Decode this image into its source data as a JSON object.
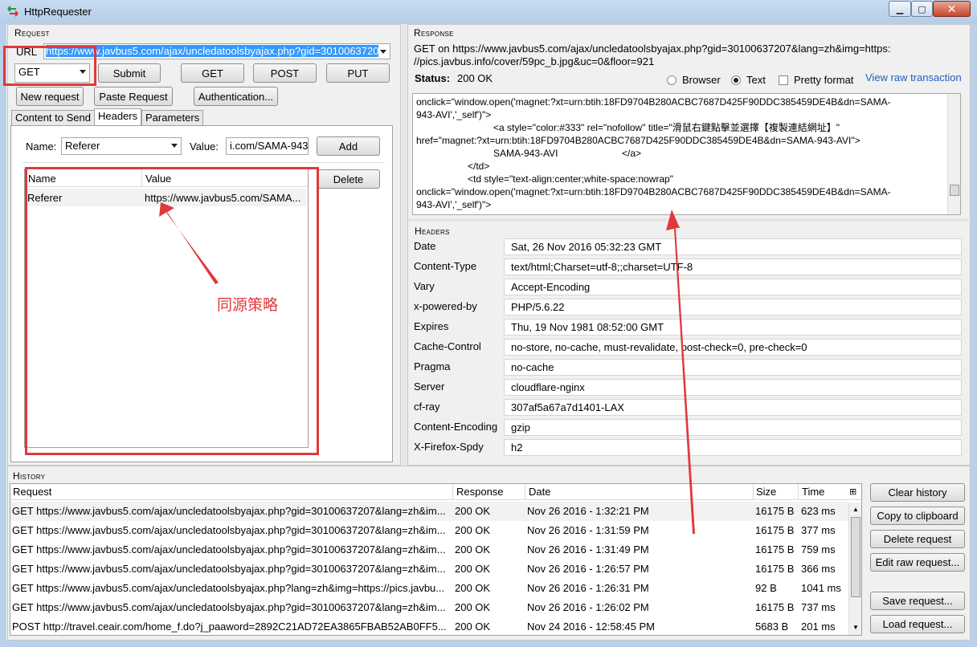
{
  "window": {
    "title": "HttpRequester"
  },
  "request": {
    "section_title": "Request",
    "url_label": "URL",
    "url_value": "https://www.javbus5.com/ajax/uncledatoolsbyajax.php?gid=3010063720",
    "method_value": "GET",
    "buttons": {
      "submit": "Submit",
      "get": "GET",
      "post": "POST",
      "put": "PUT",
      "new_request": "New request",
      "paste_request": "Paste Request",
      "authentication": "Authentication..."
    },
    "tabs": [
      "Content to Send",
      "Headers",
      "Parameters"
    ],
    "headers_tab": {
      "name_label": "Name:",
      "name_value": "Referer",
      "value_label": "Value:",
      "value_value": "i.com/SAMA-943",
      "add_label": "Add",
      "delete_label": "Delete",
      "table_columns": [
        "Name",
        "Value"
      ],
      "rows": [
        {
          "name": "Referer",
          "value": "https://www.javbus5.com/SAMA..."
        }
      ]
    },
    "annotation": "同源策略"
  },
  "response": {
    "section_title": "Response",
    "summary_line1": "GET on https://www.javbus5.com/ajax/uncledatoolsbyajax.php?gid=30100637207&lang=zh&img=https:",
    "summary_line2": "//pics.javbus.info/cover/59pc_b.jpg&uc=0&floor=921",
    "status_label": "Status:",
    "status_value": "200 OK",
    "view_options": {
      "browser": "Browser",
      "text": "Text",
      "pretty": "Pretty format",
      "selected": "Text"
    },
    "view_raw_link": "View raw transaction",
    "body_lines": [
      "onclick=\"window.open('magnet:?xt=urn:btih:18FD9704B280ACBC7687D425F90DDC385459DE4B&dn=SAMA-",
      "943-AVI','_self')\">",
      "<a style=\"color:#333\" rel=\"nofollow\" title=\"滑鼠右鍵點擊並選擇【複製連結網址】\"",
      "href=\"magnet:?xt=urn:btih:18FD9704B280ACBC7687D425F90DDC385459DE4B&dn=SAMA-943-AVI\">",
      "SAMA-943-AVI",
      "</a>",
      "</td>",
      "<td style=\"text-align:center;white-space:nowrap\"",
      "onclick=\"window.open('magnet:?xt=urn:btih:18FD9704B280ACBC7687D425F90DDC385459DE4B&dn=SAMA-",
      "943-AVI','_self')\">"
    ],
    "headers_title": "Headers",
    "headers": [
      {
        "name": "Date",
        "value": "Sat, 26 Nov 2016 05:32:23 GMT"
      },
      {
        "name": "Content-Type",
        "value": "text/html;Charset=utf-8;;charset=UTF-8"
      },
      {
        "name": "Vary",
        "value": "Accept-Encoding"
      },
      {
        "name": "x-powered-by",
        "value": "PHP/5.6.22"
      },
      {
        "name": "Expires",
        "value": "Thu, 19 Nov 1981 08:52:00 GMT"
      },
      {
        "name": "Cache-Control",
        "value": "no-store, no-cache, must-revalidate, post-check=0, pre-check=0"
      },
      {
        "name": "Pragma",
        "value": "no-cache"
      },
      {
        "name": "Server",
        "value": "cloudflare-nginx"
      },
      {
        "name": "cf-ray",
        "value": "307af5a67a7d1401-LAX"
      },
      {
        "name": "Content-Encoding",
        "value": "gzip"
      },
      {
        "name": "X-Firefox-Spdy",
        "value": "h2"
      }
    ]
  },
  "history": {
    "section_title": "History",
    "columns": {
      "request": "Request",
      "response": "Response",
      "date": "Date",
      "size": "Size",
      "time": "Time"
    },
    "rows": [
      {
        "request": "GET https://www.javbus5.com/ajax/uncledatoolsbyajax.php?gid=30100637207&lang=zh&im...",
        "response": "200 OK",
        "date": "Nov 26 2016 - 1:32:21 PM",
        "size": "16175 B",
        "time": "623 ms"
      },
      {
        "request": "GET https://www.javbus5.com/ajax/uncledatoolsbyajax.php?gid=30100637207&lang=zh&im...",
        "response": "200 OK",
        "date": "Nov 26 2016 - 1:31:59 PM",
        "size": "16175 B",
        "time": "377 ms"
      },
      {
        "request": "GET https://www.javbus5.com/ajax/uncledatoolsbyajax.php?gid=30100637207&lang=zh&im...",
        "response": "200 OK",
        "date": "Nov 26 2016 - 1:31:49 PM",
        "size": "16175 B",
        "time": "759 ms"
      },
      {
        "request": "GET https://www.javbus5.com/ajax/uncledatoolsbyajax.php?gid=30100637207&lang=zh&im...",
        "response": "200 OK",
        "date": "Nov 26 2016 - 1:26:57 PM",
        "size": "16175 B",
        "time": "366 ms"
      },
      {
        "request": "GET https://www.javbus5.com/ajax/uncledatoolsbyajax.php?lang=zh&img=https://pics.javbu...",
        "response": "200 OK",
        "date": "Nov 26 2016 - 1:26:31 PM",
        "size": "92 B",
        "time": "1041 ms"
      },
      {
        "request": "GET https://www.javbus5.com/ajax/uncledatoolsbyajax.php?gid=30100637207&lang=zh&im...",
        "response": "200 OK",
        "date": "Nov 26 2016 - 1:26:02 PM",
        "size": "16175 B",
        "time": "737 ms"
      },
      {
        "request": "POST http://travel.ceair.com/home_f.do?j_paaword=2892C21AD72EA3865FBAB52AB0FF5...",
        "response": "200 OK",
        "date": "Nov 24 2016 - 12:58:45 PM",
        "size": "5683 B",
        "time": "201 ms"
      }
    ],
    "buttons": {
      "clear": "Clear history",
      "copy": "Copy to clipboard",
      "delete": "Delete request",
      "edit_raw": "Edit raw request...",
      "save": "Save request...",
      "load": "Load request..."
    }
  },
  "colors": {
    "accent_red": "#e0393c",
    "link_blue": "#1f5fbf",
    "selection_blue": "#3399ff"
  }
}
